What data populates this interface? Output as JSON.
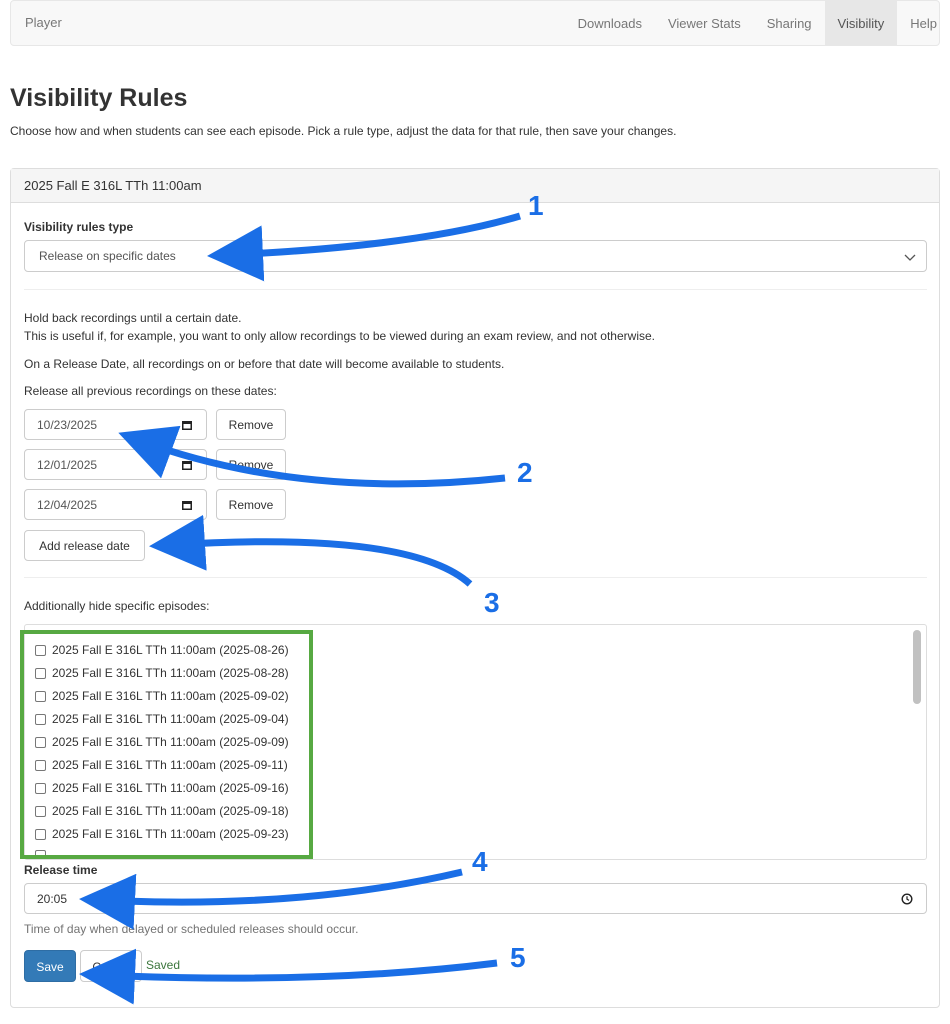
{
  "navbar": {
    "brand": "Player",
    "items": [
      {
        "label": "Downloads",
        "active": false
      },
      {
        "label": "Viewer Stats",
        "active": false
      },
      {
        "label": "Sharing",
        "active": false
      },
      {
        "label": "Visibility",
        "active": true
      },
      {
        "label": "Help",
        "active": false
      }
    ]
  },
  "page": {
    "title": "Visibility Rules",
    "intro": "Choose how and when students can see each episode. Pick a rule type, adjust the data for that rule, then save your changes."
  },
  "panel": {
    "heading": "2025 Fall E 316L TTh 11:00am",
    "rules_type_label": "Visibility rules type",
    "rules_type_value": "Release on specific dates",
    "desc_line1": "Hold back recordings until a certain date.",
    "desc_line2": "This is useful if, for example, you want to only allow recordings to be viewed during an exam review, and not otherwise.",
    "desc_line3": "On a Release Date, all recordings on or before that date will become available to students.",
    "release_dates_label": "Release all previous recordings on these dates:",
    "release_dates": [
      "10/23/2025",
      "12/01/2025",
      "12/04/2025"
    ],
    "remove_label": "Remove",
    "add_release_date_label": "Add release date",
    "hide_episodes_label": "Additionally hide specific episodes:",
    "episodes": [
      {
        "label": "2025 Fall E 316L TTh 11:00am (2025-08-26)",
        "checked": false
      },
      {
        "label": "2025 Fall E 316L TTh 11:00am (2025-08-28)",
        "checked": false
      },
      {
        "label": "2025 Fall E 316L TTh 11:00am (2025-09-02)",
        "checked": false
      },
      {
        "label": "2025 Fall E 316L TTh 11:00am (2025-09-04)",
        "checked": false
      },
      {
        "label": "2025 Fall E 316L TTh 11:00am (2025-09-09)",
        "checked": false
      },
      {
        "label": "2025 Fall E 316L TTh 11:00am (2025-09-11)",
        "checked": false
      },
      {
        "label": "2025 Fall E 316L TTh 11:00am (2025-09-16)",
        "checked": false
      },
      {
        "label": "2025 Fall E 316L TTh 11:00am (2025-09-18)",
        "checked": false
      },
      {
        "label": "2025 Fall E 316L TTh 11:00am (2025-09-23)",
        "checked": false
      }
    ],
    "release_time_label": "Release time",
    "release_time_value": "20:05",
    "release_time_help": "Time of day when delayed or scheduled releases should occur.",
    "save_label": "Save",
    "cancel_label": "Cancel",
    "saved_status": "Saved"
  },
  "annotations": {
    "callouts": [
      "1",
      "2",
      "3",
      "4",
      "5"
    ],
    "arrow_color": "#1a6ee6",
    "highlight_color": "#57a942"
  }
}
